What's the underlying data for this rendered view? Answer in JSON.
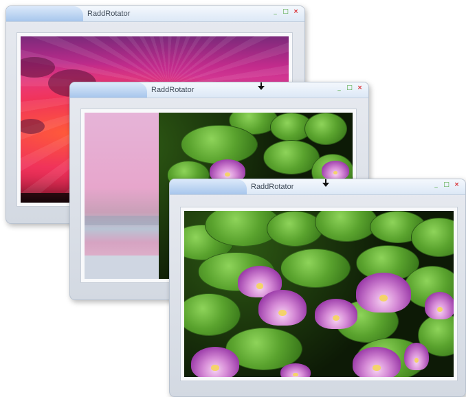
{
  "windows": [
    {
      "title": "RaddRotator",
      "image": "sunset"
    },
    {
      "title": "RaddRotator",
      "image": "sunset-to-lily-pads-transition"
    },
    {
      "title": "RaddRotator",
      "image": "lily-pads"
    }
  ],
  "controls": {
    "minimize": "_",
    "maximize": "□",
    "close": "×"
  },
  "colors": {
    "title_bar_tab": "#a7c6ec",
    "window_body": "#d3d9e2",
    "close": "#d8262b",
    "min_max": "#49a33a"
  }
}
